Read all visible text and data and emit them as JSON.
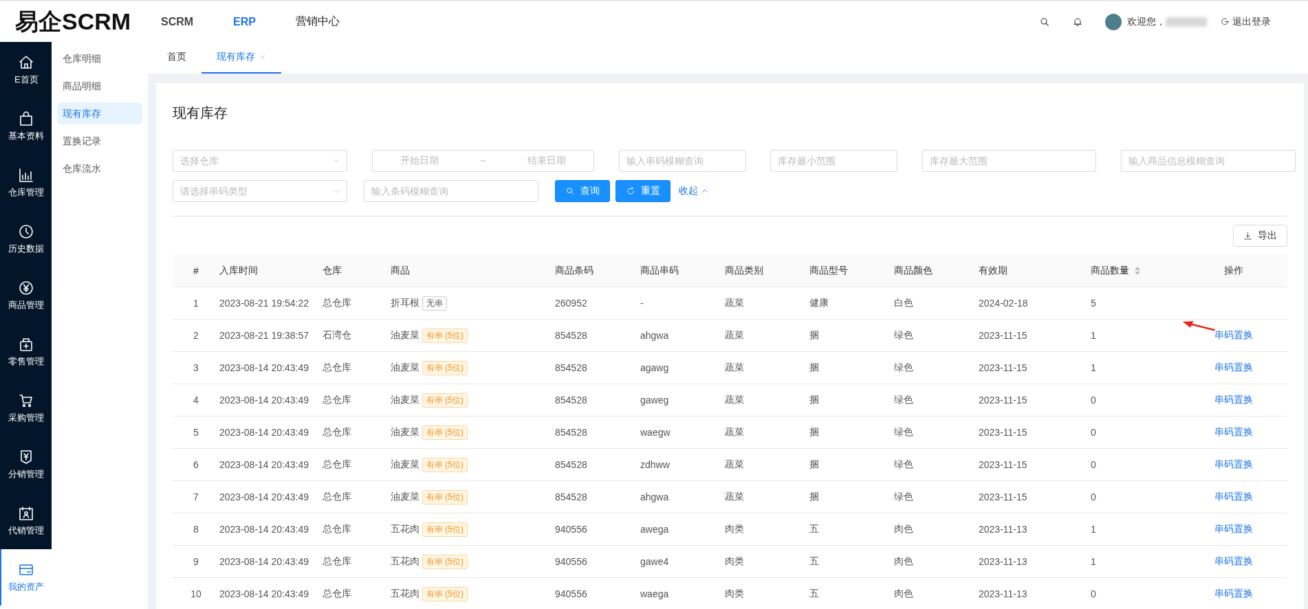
{
  "header": {
    "logo": "易企SCRM",
    "nav": [
      {
        "label": "SCRM",
        "selected": false
      },
      {
        "label": "ERP",
        "selected": true
      },
      {
        "label": "营销中心",
        "selected": false
      }
    ],
    "welcome": "欢迎您，",
    "logout": "退出登录"
  },
  "sidebar": {
    "items": [
      {
        "label": "E首页",
        "kind": "home",
        "selected": false
      },
      {
        "label": "基本资料",
        "kind": "bag",
        "selected": false
      },
      {
        "label": "仓库管理",
        "kind": "chart",
        "selected": false
      },
      {
        "label": "历史数据",
        "kind": "clock",
        "selected": false
      },
      {
        "label": "商品管理",
        "kind": "yen",
        "selected": false
      },
      {
        "label": "零售管理",
        "kind": "kit",
        "selected": false
      },
      {
        "label": "采购管理",
        "kind": "cart",
        "selected": false
      },
      {
        "label": "分销管理",
        "kind": "tag",
        "selected": false
      },
      {
        "label": "代销管理",
        "kind": "calendar",
        "selected": false
      },
      {
        "label": "我的资产",
        "kind": "card",
        "selected": true
      }
    ]
  },
  "submenu": {
    "items": [
      {
        "label": "仓库明细",
        "selected": false
      },
      {
        "label": "商品明细",
        "selected": false
      },
      {
        "label": "现有库存",
        "selected": true
      },
      {
        "label": "置换记录",
        "selected": false
      },
      {
        "label": "仓库流水",
        "selected": false
      }
    ]
  },
  "tabs": [
    {
      "label": "首页",
      "selected": false,
      "closable": false
    },
    {
      "label": "现有库存",
      "selected": true,
      "closable": true
    }
  ],
  "page": {
    "title": "现有库存"
  },
  "filters": {
    "rows": [
      [
        {
          "kind": "select",
          "placeholder": "选择仓库"
        },
        {
          "kind": "date_range",
          "start_placeholder": "开始日期",
          "separator": "~",
          "end_placeholder": "结束日期"
        },
        {
          "kind": "input",
          "placeholder": "输入串码模糊查询"
        },
        {
          "kind": "input",
          "placeholder": "库存最小范围"
        },
        {
          "kind": "input",
          "placeholder": "库存最大范围"
        },
        {
          "kind": "input",
          "placeholder": "输入商品信息模糊查询"
        }
      ],
      [
        {
          "kind": "select",
          "placeholder": "请选择串码类型"
        },
        {
          "kind": "input",
          "placeholder": "输入条码模糊查询"
        }
      ]
    ],
    "buttons": [
      {
        "label": "查询",
        "kind": "search"
      },
      {
        "label": "重置",
        "kind": "refresh"
      }
    ],
    "collapse": "收起"
  },
  "export_button": "导出",
  "table": {
    "columns": [
      {
        "label": "#",
        "sortable": false
      },
      {
        "label": "入库时间",
        "sortable": false
      },
      {
        "label": "仓库",
        "sortable": false
      },
      {
        "label": "商品",
        "sortable": false
      },
      {
        "label": "商品条码",
        "sortable": false
      },
      {
        "label": "商品串码",
        "sortable": false
      },
      {
        "label": "商品类别",
        "sortable": false
      },
      {
        "label": "商品型号",
        "sortable": false
      },
      {
        "label": "商品颜色",
        "sortable": false
      },
      {
        "label": "有效期",
        "sortable": false
      },
      {
        "label": "商品数量",
        "sortable": true
      },
      {
        "label": "操作",
        "sortable": false
      }
    ],
    "rows": [
      {
        "index": "1",
        "time": "2023-08-21 19:54:22",
        "warehouse": "总仓库",
        "product": "折耳根",
        "tag": {
          "label": "无串",
          "kind": "none"
        },
        "barcode": "260952",
        "serial": "-",
        "category": "蔬菜",
        "model": "健康",
        "product_color": "白色",
        "expiry": "2024-02-18",
        "quantity": "5"
      },
      {
        "index": "2",
        "time": "2023-08-21 19:38:57",
        "warehouse": "石湾仓",
        "product": "油麦菜",
        "tag": {
          "label": "有串 (5位)",
          "kind": "serial"
        },
        "barcode": "854528",
        "serial": "ahgwa",
        "category": "蔬菜",
        "model": "捆",
        "product_color": "绿色",
        "expiry": "2023-11-15",
        "quantity": "1",
        "action": "串码置换"
      },
      {
        "index": "3",
        "time": "2023-08-14 20:43:49",
        "warehouse": "总仓库",
        "product": "油麦菜",
        "tag": {
          "label": "有串 (5位)",
          "kind": "serial"
        },
        "barcode": "854528",
        "serial": "agawg",
        "category": "蔬菜",
        "model": "捆",
        "product_color": "绿色",
        "expiry": "2023-11-15",
        "quantity": "1",
        "action": "串码置换"
      },
      {
        "index": "4",
        "time": "2023-08-14 20:43:49",
        "warehouse": "总仓库",
        "product": "油麦菜",
        "tag": {
          "label": "有串 (5位)",
          "kind": "serial"
        },
        "barcode": "854528",
        "serial": "gaweg",
        "category": "蔬菜",
        "model": "捆",
        "product_color": "绿色",
        "expiry": "2023-11-15",
        "quantity": "0",
        "action": "串码置换"
      },
      {
        "index": "5",
        "time": "2023-08-14 20:43:49",
        "warehouse": "总仓库",
        "product": "油麦菜",
        "tag": {
          "label": "有串 (5位)",
          "kind": "serial"
        },
        "barcode": "854528",
        "serial": "waegw",
        "category": "蔬菜",
        "model": "捆",
        "product_color": "绿色",
        "expiry": "2023-11-15",
        "quantity": "0",
        "action": "串码置换"
      },
      {
        "index": "6",
        "time": "2023-08-14 20:43:49",
        "warehouse": "总仓库",
        "product": "油麦菜",
        "tag": {
          "label": "有串 (5位)",
          "kind": "serial"
        },
        "barcode": "854528",
        "serial": "zdhww",
        "category": "蔬菜",
        "model": "捆",
        "product_color": "绿色",
        "expiry": "2023-11-15",
        "quantity": "0",
        "action": "串码置换"
      },
      {
        "index": "7",
        "time": "2023-08-14 20:43:49",
        "warehouse": "总仓库",
        "product": "油麦菜",
        "tag": {
          "label": "有串 (5位)",
          "kind": "serial"
        },
        "barcode": "854528",
        "serial": "ahgwa",
        "category": "蔬菜",
        "model": "捆",
        "product_color": "绿色",
        "expiry": "2023-11-15",
        "quantity": "0",
        "action": "串码置换"
      },
      {
        "index": "8",
        "time": "2023-08-14 20:43:49",
        "warehouse": "总仓库",
        "product": "五花肉",
        "tag": {
          "label": "有串 (5位)",
          "kind": "serial"
        },
        "barcode": "940556",
        "serial": "awega",
        "category": "肉类",
        "model": "五",
        "product_color": "肉色",
        "expiry": "2023-11-13",
        "quantity": "1",
        "action": "串码置换"
      },
      {
        "index": "9",
        "time": "2023-08-14 20:43:49",
        "warehouse": "总仓库",
        "product": "五花肉",
        "tag": {
          "label": "有串 (5位)",
          "kind": "serial"
        },
        "barcode": "940556",
        "serial": "gawe4",
        "category": "肉类",
        "model": "五",
        "product_color": "肉色",
        "expiry": "2023-11-13",
        "quantity": "1",
        "action": "串码置换"
      },
      {
        "index": "10",
        "time": "2023-08-14 20:43:49",
        "warehouse": "总仓库",
        "product": "五花肉",
        "tag": {
          "label": "有串 (5位)",
          "kind": "serial"
        },
        "barcode": "940556",
        "serial": "waega",
        "category": "肉类",
        "model": "五",
        "product_color": "肉色",
        "expiry": "2023-11-13",
        "quantity": "0",
        "action": "串码置换"
      }
    ]
  }
}
